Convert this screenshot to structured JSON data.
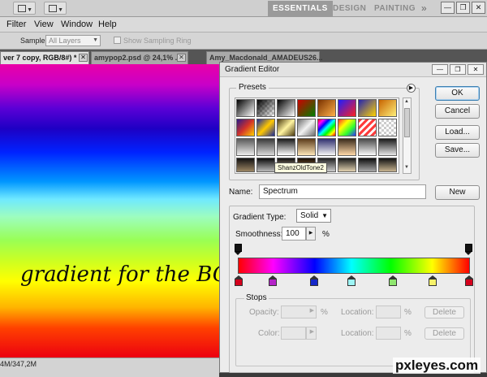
{
  "workspace": {
    "essentials": "ESSENTIALS",
    "design": "DESIGN",
    "painting": "PAINTING",
    "more": "»"
  },
  "window_controls": {
    "minimize": "—",
    "restore": "❐",
    "close": "✕"
  },
  "menu": [
    "Filter",
    "View",
    "Window",
    "Help"
  ],
  "options": {
    "sample_label": "Sample:",
    "sample_value": "All Layers",
    "show_ring_label": "Show Sampling Ring"
  },
  "doc_tabs": [
    {
      "label": "ver 7 copy, RGB/8#) *"
    },
    {
      "label": "amypop2.psd @ 24,1% ..."
    },
    {
      "label": "Amy_Macdonald_AMADEUS26..."
    }
  ],
  "canvas": {
    "text": "gradient for the BG"
  },
  "status": {
    "text": "4M/347,2M"
  },
  "dialog": {
    "title": "Gradient Editor",
    "presets_label": "Presets",
    "tooltip": "ShanzOldTone2",
    "ok": "OK",
    "cancel": "Cancel",
    "load": "Load...",
    "save": "Save...",
    "name_label": "Name:",
    "name_value": "Spectrum",
    "new": "New",
    "gradient_type_label": "Gradient Type:",
    "gradient_type_value": "Solid",
    "smoothness_label": "Smoothness:",
    "smoothness_value": "100",
    "percent": "%",
    "stops_label": "Stops",
    "opacity_label": "Opacity:",
    "color_label": "Color:",
    "location_label": "Location:",
    "delete": "Delete"
  },
  "colors": {
    "ramp": [
      "#ff0000",
      "#ff00ff",
      "#0000ff",
      "#00ffff",
      "#00ff00",
      "#ffff00",
      "#ff0000"
    ],
    "stops": [
      "#d4001c",
      "#b424c8",
      "#1528c8",
      "#9df5f5",
      "#8fe66f",
      "#f7f26a",
      "#d4001c"
    ]
  },
  "watermark": "pxleyes.com"
}
